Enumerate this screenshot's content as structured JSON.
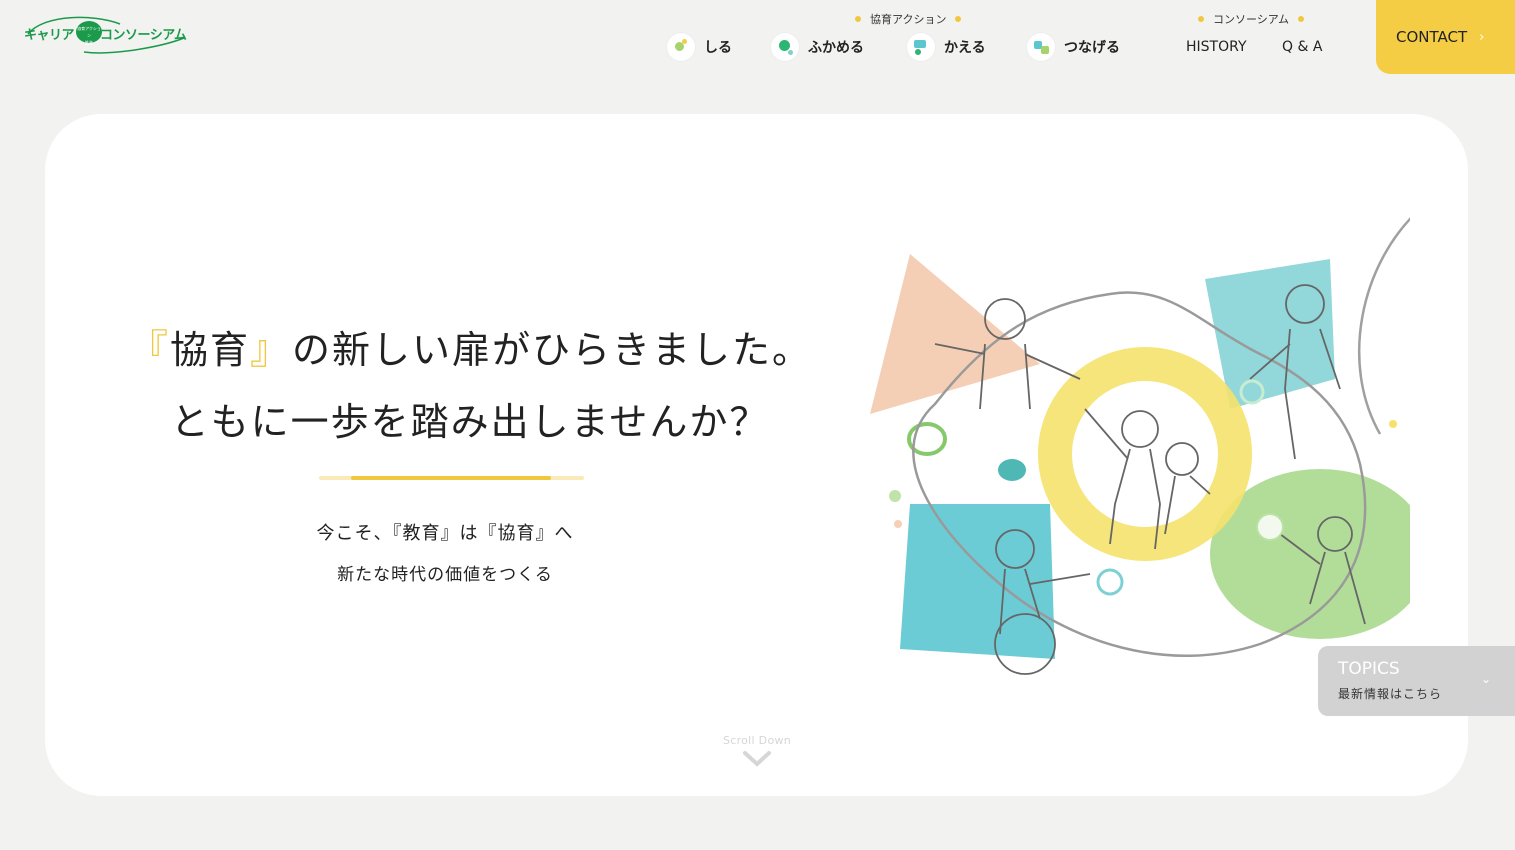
{
  "header": {
    "logo": {
      "text_left": "キャリア",
      "badge_top": "協育アクション",
      "badge_bottom": "推進",
      "text_right": "コンソーシアム",
      "brand_color": "#1a9a4a"
    },
    "group_action_label": "協育アクション",
    "group_consortium_label": "コンソーシアム",
    "nav_actions": [
      {
        "label": "しる",
        "icon": "know-icon"
      },
      {
        "label": "ふかめる",
        "icon": "deepen-icon"
      },
      {
        "label": "かえる",
        "icon": "change-icon"
      },
      {
        "label": "つなげる",
        "icon": "connect-icon"
      }
    ],
    "nav_links": [
      "HISTORY",
      "Q & A"
    ],
    "contact_label": "CONTACT",
    "contact_arrow": "›",
    "accent_color": "#f4cd45"
  },
  "hero": {
    "headline_line1_prefix": "『",
    "headline_line1_keyword": "協育",
    "headline_line1_suffix_bracket": "』",
    "headline_line1_rest": "の新しい扉がひらきました。",
    "headline_line2": "ともに一歩を踏み出しませんか？",
    "sub_line1": "今こそ、『教育』は『協育』へ",
    "sub_line2": "新たな時代の価値をつくる",
    "scroll_label": "Scroll Down"
  },
  "topics": {
    "title": "TOPICS",
    "subtitle": "最新情報はこちら",
    "chevron": "⌄"
  }
}
